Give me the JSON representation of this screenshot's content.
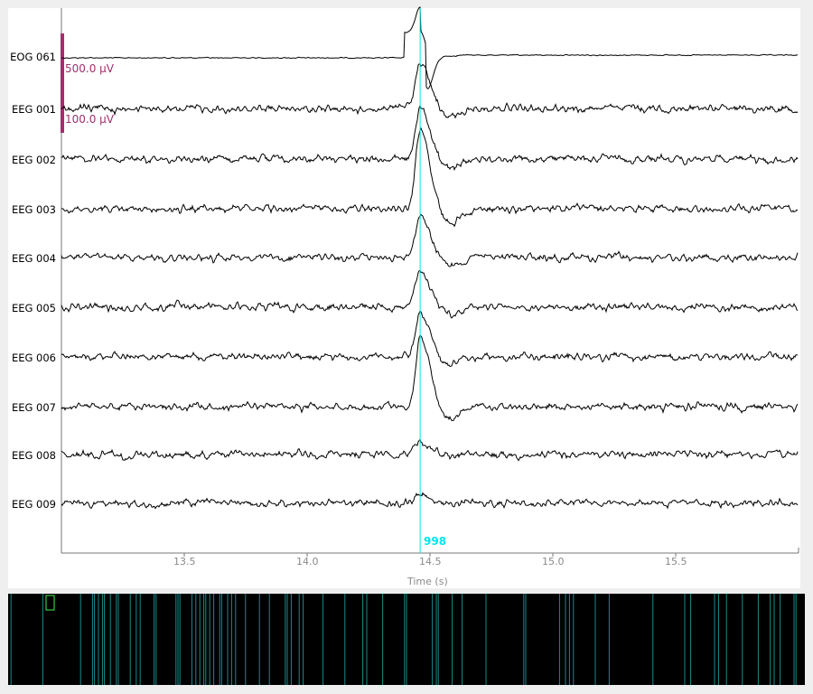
{
  "channels": [
    {
      "name": "EOG 061",
      "offset": 62,
      "kind": "eog"
    },
    {
      "name": "EEG 001",
      "offset": 120,
      "kind": "eeg",
      "amp": 50
    },
    {
      "name": "EEG 002",
      "offset": 176,
      "kind": "eeg",
      "amp": 58
    },
    {
      "name": "EEG 003",
      "offset": 231,
      "kind": "eeg",
      "amp": 85
    },
    {
      "name": "EEG 004",
      "offset": 285,
      "kind": "eeg",
      "amp": 50
    },
    {
      "name": "EEG 005",
      "offset": 340,
      "kind": "eeg",
      "amp": 42
    },
    {
      "name": "EEG 006",
      "offset": 395,
      "kind": "eeg",
      "amp": 48
    },
    {
      "name": "EEG 007",
      "offset": 450,
      "kind": "eeg",
      "amp": 76
    },
    {
      "name": "EEG 008",
      "offset": 503,
      "kind": "eeg",
      "amp": 13
    },
    {
      "name": "EEG 009",
      "offset": 557,
      "kind": "eeg",
      "amp": 10
    }
  ],
  "scale_bars": [
    "500.0 µV",
    "100.0 µV"
  ],
  "scale_color": "#a0306e",
  "x_axis": {
    "label": "Time (s)",
    "ticks": [
      "13.5",
      "14.0",
      "14.5",
      "15.0",
      "15.5"
    ],
    "tick_values": [
      13.5,
      14.0,
      14.5,
      15.0,
      15.5
    ],
    "range": [
      13.0,
      16.0
    ]
  },
  "event": {
    "label": "998",
    "time": 14.46,
    "color": "#00e5ee"
  },
  "overview": {
    "event_times": [
      0.1,
      1.7,
      3.6,
      4.2,
      4.3,
      4.5,
      4.7,
      4.8,
      5.1,
      5.4,
      5.5,
      6.1,
      6.4,
      6.6,
      7.3,
      7.4,
      8.4,
      8.5,
      8.6,
      9.2,
      9.4,
      9.6,
      9.8,
      9.9,
      10.1,
      10.3,
      10.6,
      10.7,
      11.0,
      11.2,
      11.4,
      11.9,
      12.6,
      13.1,
      13.9,
      14.0,
      14.2,
      14.6,
      14.8,
      15.8,
      16.9,
      17.8,
      18.0,
      18.8,
      19.9,
      20.0,
      21.3,
      21.5,
      21.6,
      22.3,
      22.8,
      24.0,
      25.9,
      26.0,
      27.7,
      28.0,
      28.2,
      28.4,
      29.5,
      30.2,
      32.4,
      34.0,
      34.3,
      35.5,
      35.7,
      36.1,
      36.9,
      37.7,
      38.3,
      38.5,
      38.8,
      39.5,
      39.6
    ],
    "total": 40.0,
    "event_color": "#1a8a8a",
    "view_color": "#2ecc40"
  }
}
